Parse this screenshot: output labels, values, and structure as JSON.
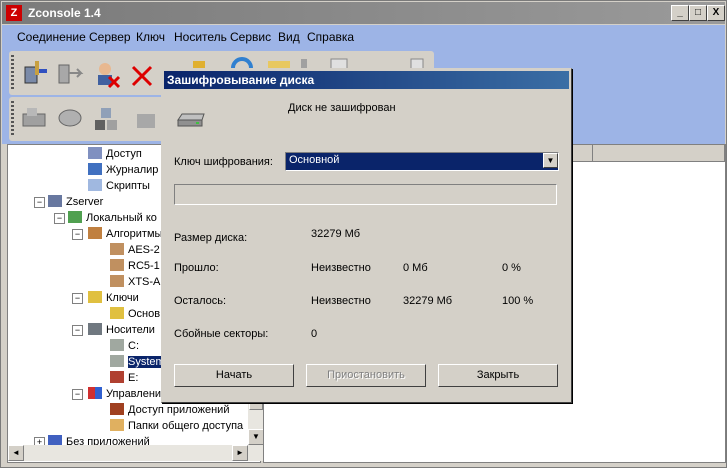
{
  "app": {
    "title": "Zconsole 1.4",
    "icon_glyph": "Z"
  },
  "window_controls": {
    "minimize": "_",
    "maximize": "□",
    "close": "X"
  },
  "menu": [
    "Соединение",
    "Сервер",
    "Ключ",
    "Носитель",
    "Сервис",
    "Вид",
    "Справка"
  ],
  "tree": {
    "items": [
      {
        "label": "Доступ",
        "icon": "access-icon"
      },
      {
        "label": "Журналир",
        "icon": "journal-icon"
      },
      {
        "label": "Скрипты",
        "icon": "scripts-icon"
      },
      {
        "label": "Zserver",
        "icon": "server-icon"
      },
      {
        "label": "Локальный ко",
        "icon": "local-computer-icon"
      },
      {
        "label": "Алгоритмы",
        "icon": "algorithms-icon"
      },
      {
        "label": "AES-2",
        "icon": "algorithm-icon"
      },
      {
        "label": "RC5-1",
        "icon": "algorithm-icon"
      },
      {
        "label": "XTS-A",
        "icon": "algorithm-icon"
      },
      {
        "label": "Ключи",
        "icon": "keys-icon"
      },
      {
        "label": "Основ",
        "icon": "key-icon"
      },
      {
        "label": "Носители",
        "icon": "media-icon"
      },
      {
        "label": "C:",
        "icon": "drive-icon"
      },
      {
        "label": "System",
        "icon": "drive-icon"
      },
      {
        "label": "E:",
        "icon": "drive-locked-icon"
      },
      {
        "label": "Управлени",
        "icon": "management-icon"
      },
      {
        "label": "Доступ приложений",
        "icon": "app-access-icon"
      },
      {
        "label": "Папки общего доступа",
        "icon": "shared-folders-icon"
      },
      {
        "label": "Без приложений",
        "icon": "no-apps-icon"
      }
    ]
  },
  "dialog": {
    "title": "Зашифровывание диска",
    "status": "Диск не зашифрован",
    "key_label": "Ключ шифрования:",
    "key_value": "Основной",
    "progress": 0,
    "disk_size_label": "Размер диска:",
    "disk_size_value": "32279 Мб",
    "elapsed_label": "Прошло:",
    "elapsed_time": "Неизвестно",
    "elapsed_size": "0 Мб",
    "elapsed_percent": "0 %",
    "remaining_label": "Осталось:",
    "remaining_time": "Неизвестно",
    "remaining_size": "32279 Мб",
    "remaining_percent": "100 %",
    "bad_sectors_label": "Сбойные секторы:",
    "bad_sectors_value": "0",
    "start_button": "Начать",
    "pause_button": "Приостановить",
    "close_button": "Закрыть"
  },
  "colors": {
    "selection": "#0a246a",
    "toolbar_band": "#9db4e6",
    "chrome": "#d4d0c8"
  }
}
